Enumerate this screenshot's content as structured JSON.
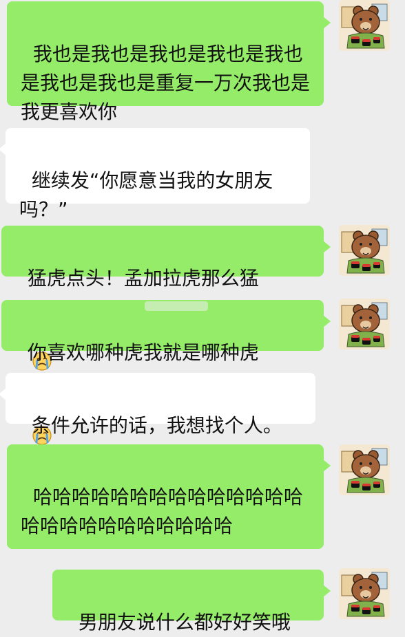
{
  "conversation": {
    "messages": [
      {
        "side": "mine",
        "text": "我也是我也是我也是我也是我也是我也是我也是重复一万次我也是我更喜欢你"
      },
      {
        "side": "theirs",
        "text": "继续发“你愿意当我的女朋友吗？”"
      },
      {
        "side": "mine",
        "text": "猛虎点头！孟加拉虎那么猛",
        "emoji": "crying-emoji"
      },
      {
        "side": "mine",
        "text": "你喜欢哪种虎我就是哪种虎",
        "emoji": "crying-emoji"
      },
      {
        "side": "theirs",
        "text": "条件允许的话，我想找个人。"
      },
      {
        "side": "mine",
        "text": "哈哈哈哈哈哈哈哈哈哈哈哈哈哈哈哈哈哈哈哈哈哈哈哈哈"
      },
      {
        "side": "mine",
        "text": "男朋友说什么都好好笑哦"
      }
    ]
  },
  "avatar": {
    "icon": "brown-bear-avatar-icon"
  },
  "colors": {
    "background": "#ededed",
    "mine_bubble": "#95ec69",
    "theirs_bubble": "#ffffff",
    "text": "#111111"
  }
}
